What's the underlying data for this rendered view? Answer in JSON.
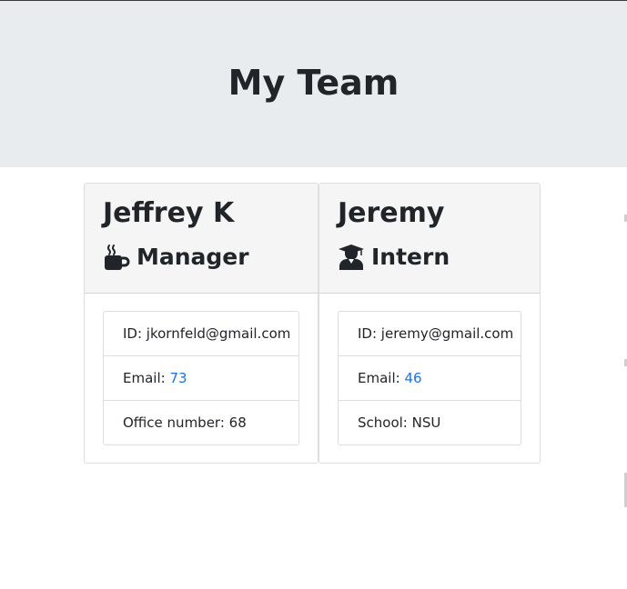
{
  "header": {
    "title": "My Team"
  },
  "team": [
    {
      "name": "Jeffrey K",
      "role": "Manager",
      "role_icon": "coffee-mug-icon",
      "id_label": "ID: ",
      "id_value": "jkornfeld@gmail.com",
      "email_label": "Email: ",
      "email_value": "73",
      "extra_label": "Office number: ",
      "extra_value": "68"
    },
    {
      "name": "Jeremy",
      "role": "Intern",
      "role_icon": "graduate-icon",
      "id_label": "ID: ",
      "id_value": "jeremy@gmail.com",
      "email_label": "Email: ",
      "email_value": "46",
      "extra_label": "School: ",
      "extra_value": "NSU"
    }
  ],
  "colors": {
    "header_bg": "#e9ecef",
    "card_header_bg": "#f5f5f5",
    "link": "#1a73e8",
    "text": "#212529"
  }
}
